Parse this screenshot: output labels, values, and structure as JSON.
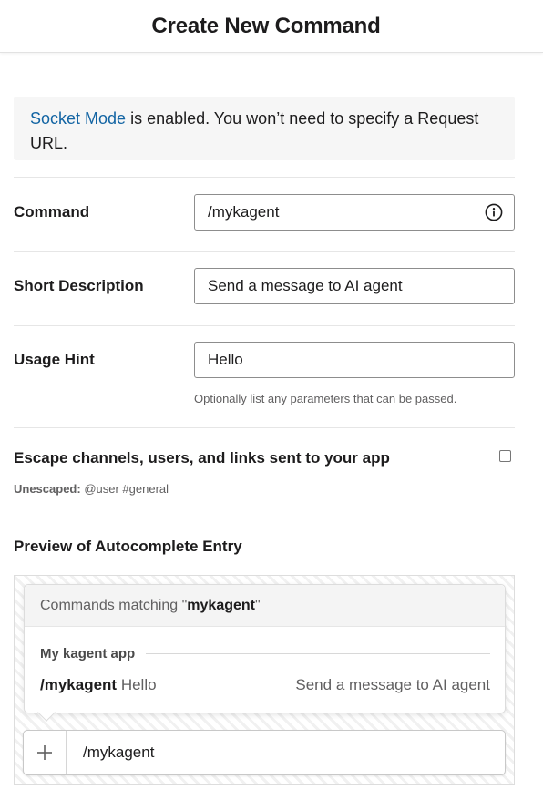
{
  "header": {
    "title": "Create New Command"
  },
  "notice": {
    "link_text": "Socket Mode",
    "text": " is enabled. You won’t need to specify a Request URL."
  },
  "form": {
    "command": {
      "label": "Command",
      "value": "/mykagent",
      "icon": "info-icon"
    },
    "short_description": {
      "label": "Short Description",
      "value": "Send a message to AI agent"
    },
    "usage_hint": {
      "label": "Usage Hint",
      "value": "Hello",
      "help": "Optionally list any parameters that can be passed."
    },
    "escape": {
      "label": "Escape channels, users, and links sent to your app",
      "checked": false,
      "unescaped_label": "Unescaped:",
      "unescaped_example": " @user #general"
    }
  },
  "preview": {
    "title": "Preview of Autocomplete Entry",
    "header_prefix": "Commands matching \"",
    "header_query": "mykagent",
    "header_suffix": "\"",
    "app_name": "My kagent app",
    "command": "/mykagent",
    "hint": " Hello",
    "description": "Send a message to AI agent",
    "composer_text": "/mykagent",
    "composer_icon": "plus-icon"
  },
  "colors": {
    "link": "#1264a3",
    "notice_bg": "#f6f6f6",
    "text": "#1d1c1d",
    "muted": "#616061"
  }
}
